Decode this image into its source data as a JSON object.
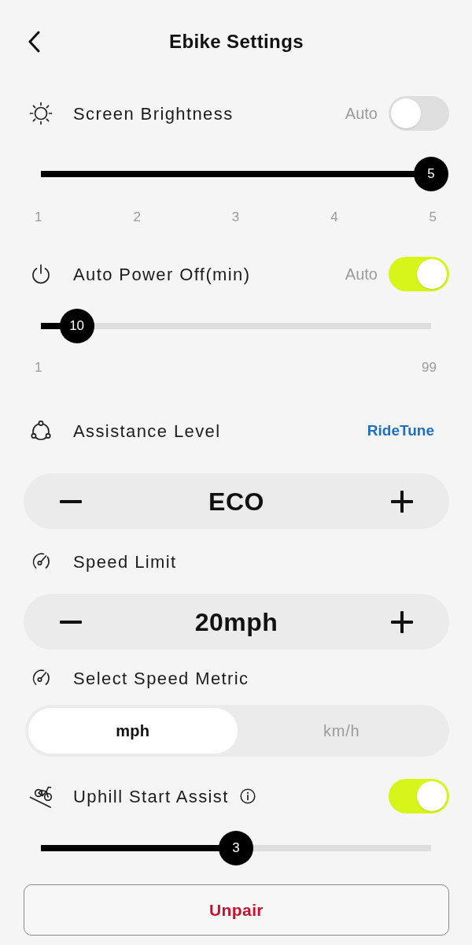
{
  "header": {
    "title": "Ebike Settings"
  },
  "screen_brightness": {
    "label": "Screen Brightness",
    "auto_label": "Auto",
    "auto": false,
    "slider": {
      "level": 1,
      "value": "5",
      "ticks": [
        "1",
        "2",
        "3",
        "4",
        "5"
      ]
    }
  },
  "auto_power_off": {
    "label": "Auto Power Off(min)",
    "auto_label": "Auto",
    "auto": true,
    "slider": {
      "level": 0.092,
      "value": "10",
      "ticks": [
        "1",
        "99"
      ]
    }
  },
  "assistance_level": {
    "label": "Assistance Level",
    "link": "RideTune",
    "stepper": {
      "value": "ECO"
    }
  },
  "speed_limit": {
    "label": "Speed Limit",
    "stepper": {
      "value": "20mph"
    }
  },
  "speed_metric": {
    "label": "Select Speed Metric",
    "options": [
      {
        "label": "mph",
        "selected": true
      },
      {
        "label": "km/h",
        "selected": false
      }
    ]
  },
  "uphill_start_assist": {
    "label": "Uphill Start Assist",
    "on": true,
    "slider": {
      "level": 0.5,
      "value": "3"
    }
  },
  "unpair_button": {
    "label": "Unpair"
  }
}
